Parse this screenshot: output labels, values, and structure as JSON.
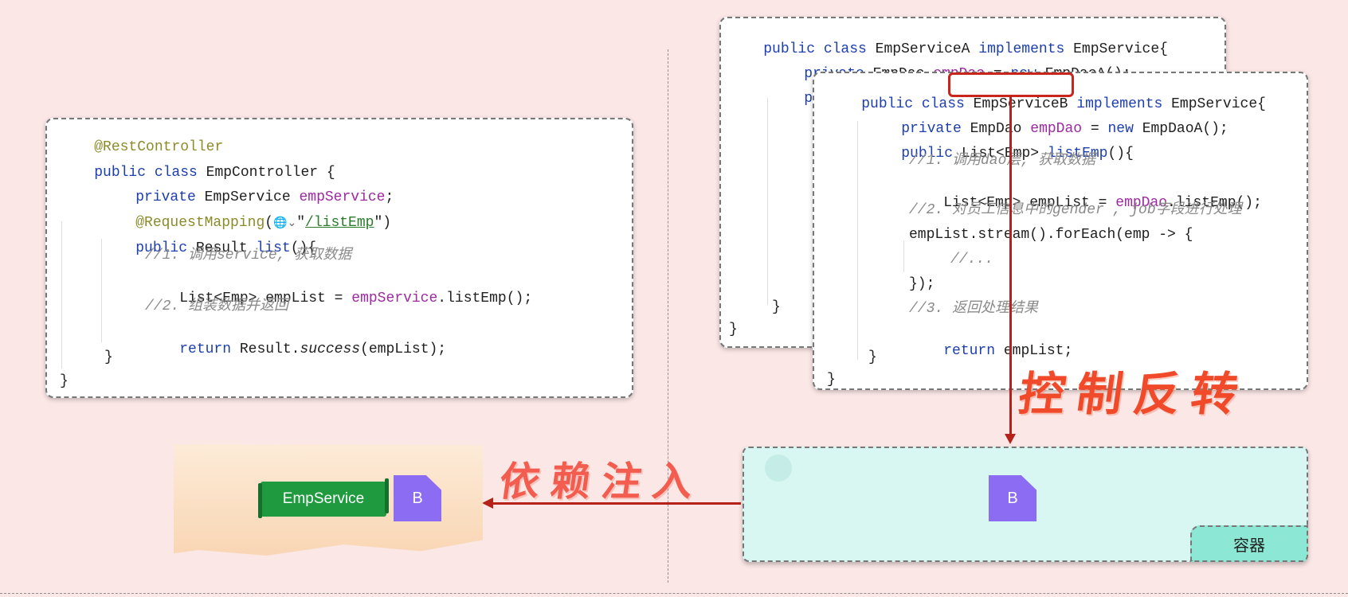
{
  "left_card": {
    "line1": "@RestController",
    "line2_kw": "public class ",
    "line2_name": "EmpController {",
    "line3_kw": "private ",
    "line3_type": "EmpService ",
    "line3_field": "empService",
    "line3_end": ";",
    "line4_ann": "@RequestMapping",
    "line4_open": "(",
    "line4_icon": "🌐⌄",
    "line4_q1": "\"",
    "line4_path": "/listEmp",
    "line4_q2": "\")",
    "line5_kw": "public ",
    "line5_type": "Result ",
    "line5_method": "list",
    "line5_end": "(){",
    "line6": "//1. 调用service, 获取数据",
    "line7_a": "List<Emp> empList = ",
    "line7_field": "empService",
    "line7_b": ".listEmp();",
    "line8": "//2. 组装数据并返回",
    "line9_kw": "return ",
    "line9_a": "Result.",
    "line9_it": "success",
    "line9_b": "(empList);",
    "line10": "}",
    "line11": "}"
  },
  "card_a": {
    "line1_kw1": "public class ",
    "line1_name": "EmpServiceA ",
    "line1_kw2": "implements ",
    "line1_iface": "EmpService{",
    "line2_kw": "private ",
    "line2_type": "EmpDao ",
    "line2_field": "empDao",
    "line2_eq": " = ",
    "line2_kw2": "new ",
    "line2_end": "EmpDaoA();",
    "line3_kw": "publ",
    "line_close1": "}",
    "line_close2": "}"
  },
  "card_b": {
    "line1_kw1": "public class ",
    "line1_name": "EmpServiceB",
    "line1_kw2": " implements ",
    "line1_iface": "EmpService{",
    "line2_kw": "private ",
    "line2_type": "EmpDao ",
    "line2_field": "empDao",
    "line2_eq": " = ",
    "line2_kw2": "new ",
    "line2_end": "EmpDaoA();",
    "line3_kw": "public ",
    "line3_type": "List<Emp> ",
    "line3_method": "listEmp",
    "line3_end": "(){",
    "line4": "//1. 调用dao层, 获取数据",
    "line5_a": "List<Emp> empList = ",
    "line5_field": "empDao",
    "line5_b": ".listEmp();",
    "line6": "//2. 对员工信息中的gender , job字段进行处理",
    "line7": "empList.stream().forEach(emp -> {",
    "line8": "//...",
    "line9": "});",
    "line10": "//3. 返回处理结果",
    "line11_kw": "return ",
    "line11_a": "empList;",
    "line12": "}",
    "line13": "}"
  },
  "labels": {
    "ioc": "控制反转",
    "di": "依赖注入",
    "emp_service_tag": "EmpService",
    "bean_left": "B",
    "bean_container": "B",
    "container": "容器"
  },
  "colors": {
    "background": "#fbe7e6",
    "arrow": "#b52219",
    "keyword": "#1d3fae",
    "field": "#9c2aa0",
    "bean": "#8c6cf2",
    "container": "#d8f7f2"
  }
}
